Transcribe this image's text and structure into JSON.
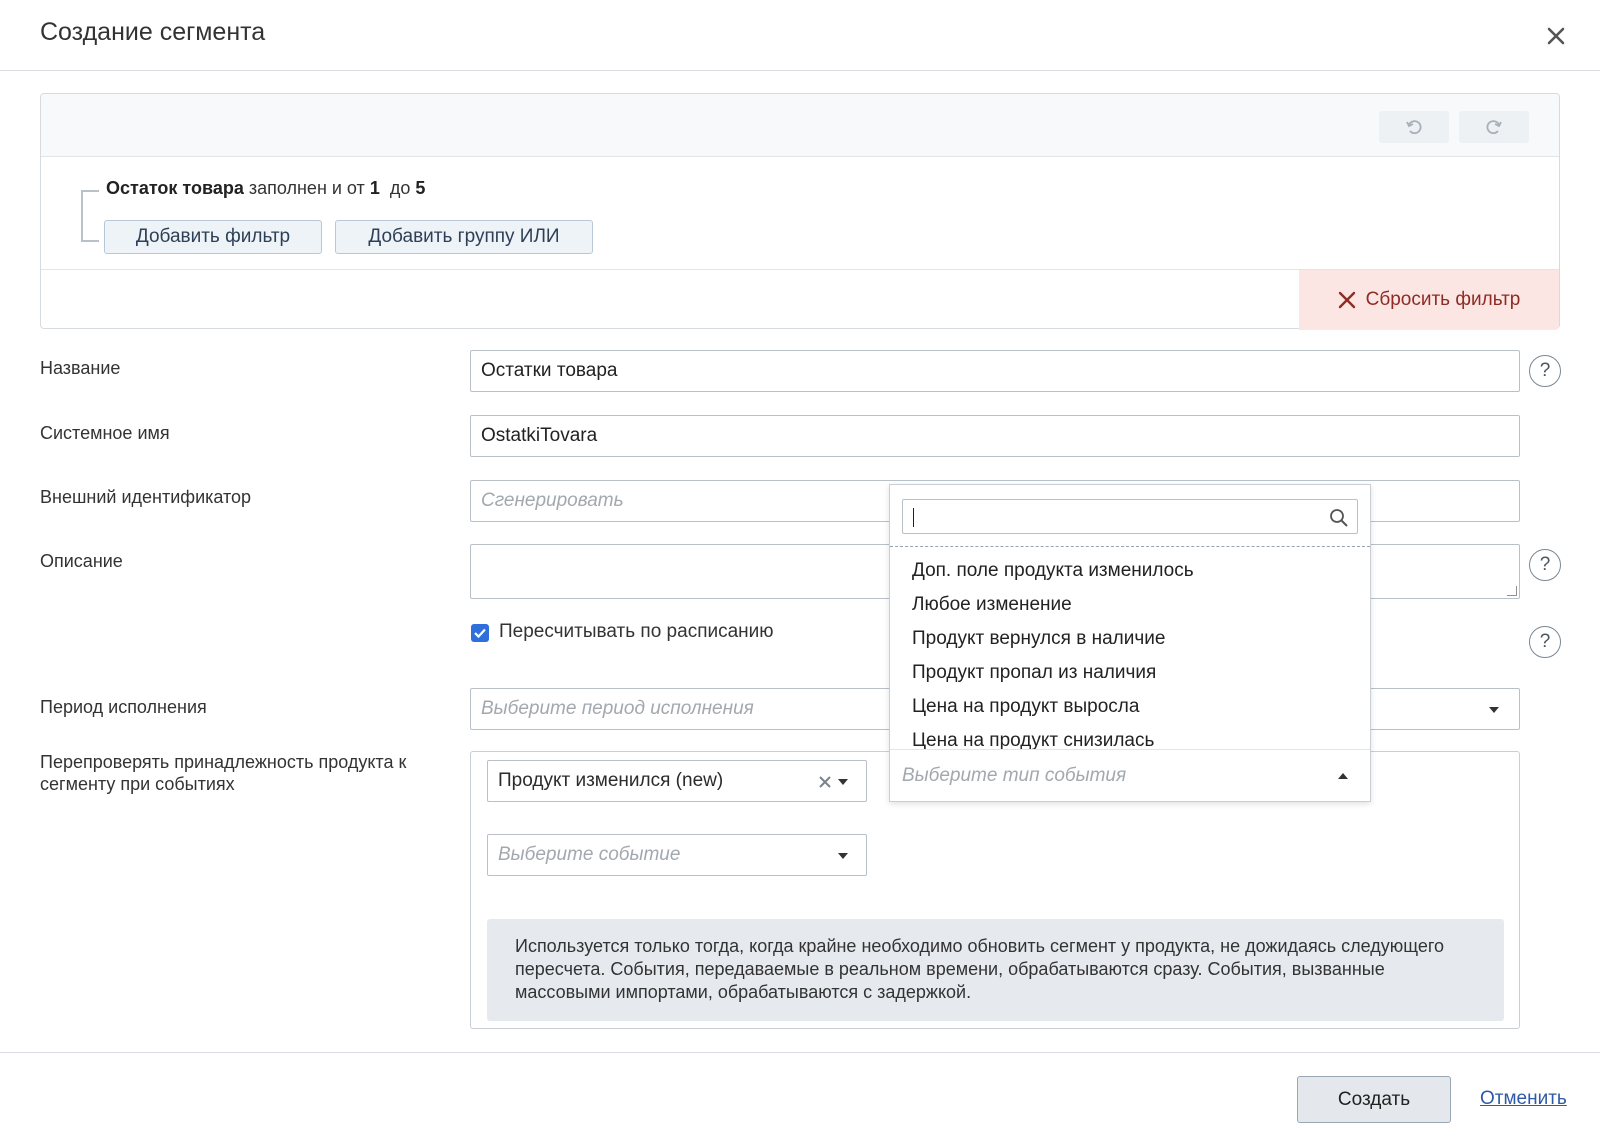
{
  "modal": {
    "title": "Создание сегмента",
    "close_icon": "close-icon"
  },
  "filter": {
    "undo_icon": "undo-icon",
    "redo_icon": "redo-icon",
    "condition": {
      "field": "Остаток товара",
      "text_filled": "заполнен и от",
      "from": "1",
      "text_to": "до",
      "to": "5"
    },
    "add_filter_label": "Добавить фильтр",
    "add_or_group_label": "Добавить группу ИЛИ",
    "reset_label": "Сбросить фильтр",
    "reset_color": "#8e2c23"
  },
  "form": {
    "name": {
      "label": "Название",
      "value": "Остатки товара"
    },
    "system_name": {
      "label": "Системное имя",
      "value": "OstatkiTovara"
    },
    "external_id": {
      "label": "Внешний идентификатор",
      "placeholder": "Сгенерировать"
    },
    "description": {
      "label": "Описание",
      "value": ""
    },
    "recalc": {
      "label": "Пересчитывать по расписанию",
      "checked": true
    },
    "period": {
      "label": "Период исполнения",
      "placeholder": "Выберите период исполнения"
    },
    "recheck": {
      "label_line1": "Перепроверять принадлежность продукта к",
      "label_line2": "сегменту при событиях",
      "selected_event": "Продукт изменился (new)",
      "event_type_placeholder": "Выберите тип события",
      "event_placeholder": "Выберите событие",
      "info_text": "Используется только тогда, когда крайне необходимо обновить сегмент у продукта, не дожидаясь следующего пересчета. События, передаваемые в реальном времени, обрабатываются сразу. События, вызванные массовыми импортами, обрабатываются с задержкой."
    }
  },
  "dropdown": {
    "search_value": "",
    "items": [
      "Доп. поле продукта изменилось",
      "Любое изменение",
      "Продукт вернулся в наличие",
      "Продукт пропал из наличия",
      "Цена на продукт выросла",
      "Цена на продукт снизилась"
    ]
  },
  "footer": {
    "create_label": "Создать",
    "cancel_label": "Отменить"
  },
  "colors": {
    "accent": "#2f6fdc",
    "reset_bg": "#fbe6e4",
    "info_bg": "#e6eaef"
  }
}
